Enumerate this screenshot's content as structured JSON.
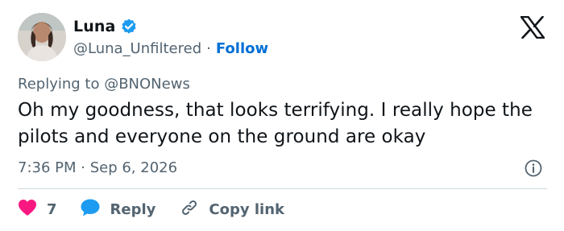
{
  "author": {
    "display_name": "Luna",
    "handle": "@Luna_Unfiltered",
    "separator": "·",
    "follow_label": "Follow",
    "verified": true
  },
  "reply_context": "Replying to @BNONews",
  "tweet": {
    "text": "Oh my goodness, that looks terrifying. I really hope the pilots and everyone on the ground are okay"
  },
  "meta": {
    "timestamp": "7:36 PM · Sep 6, 2026"
  },
  "actions": {
    "like_count": "7",
    "reply_label": "Reply",
    "copy_link_label": "Copy link"
  },
  "icons": {
    "verified": "verified-badge-icon",
    "brand": "x-logo-icon",
    "info": "info-icon",
    "like": "heart-icon",
    "reply": "speech-bubble-icon",
    "copy": "link-icon"
  },
  "colors": {
    "text_primary": "#0f1419",
    "text_secondary": "#536471",
    "accent_blue": "#006fd6",
    "verified_blue": "#1d9bf0",
    "like_pink": "#f91880",
    "divider": "#cfd9de"
  }
}
